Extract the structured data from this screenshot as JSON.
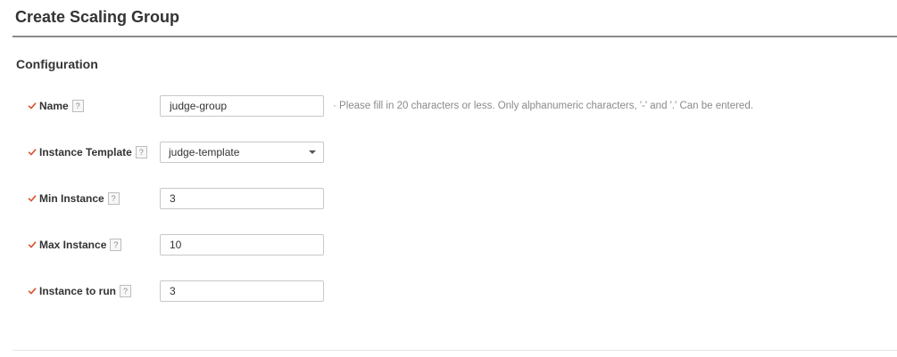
{
  "page": {
    "title": "Create Scaling Group"
  },
  "section": {
    "title": "Configuration"
  },
  "colors": {
    "required_check": "#d9502c",
    "border": "#c8c8c8",
    "hint": "#8a8a8a"
  },
  "icons": {
    "required": "check-icon",
    "help": "question-icon",
    "dropdown": "chevron-down-icon"
  },
  "form": {
    "help_glyph": "?",
    "name": {
      "label": "Name",
      "value": "judge-group",
      "hint": "· Please fill in 20 characters or less. Only alphanumeric characters, '-' and '.' Can be entered."
    },
    "instance_template": {
      "label": "Instance Template",
      "value": "judge-template"
    },
    "min_instance": {
      "label": "Min Instance",
      "value": "3"
    },
    "max_instance": {
      "label": "Max Instance",
      "value": "10"
    },
    "instance_to_run": {
      "label": "Instance to run",
      "value": "3"
    }
  }
}
